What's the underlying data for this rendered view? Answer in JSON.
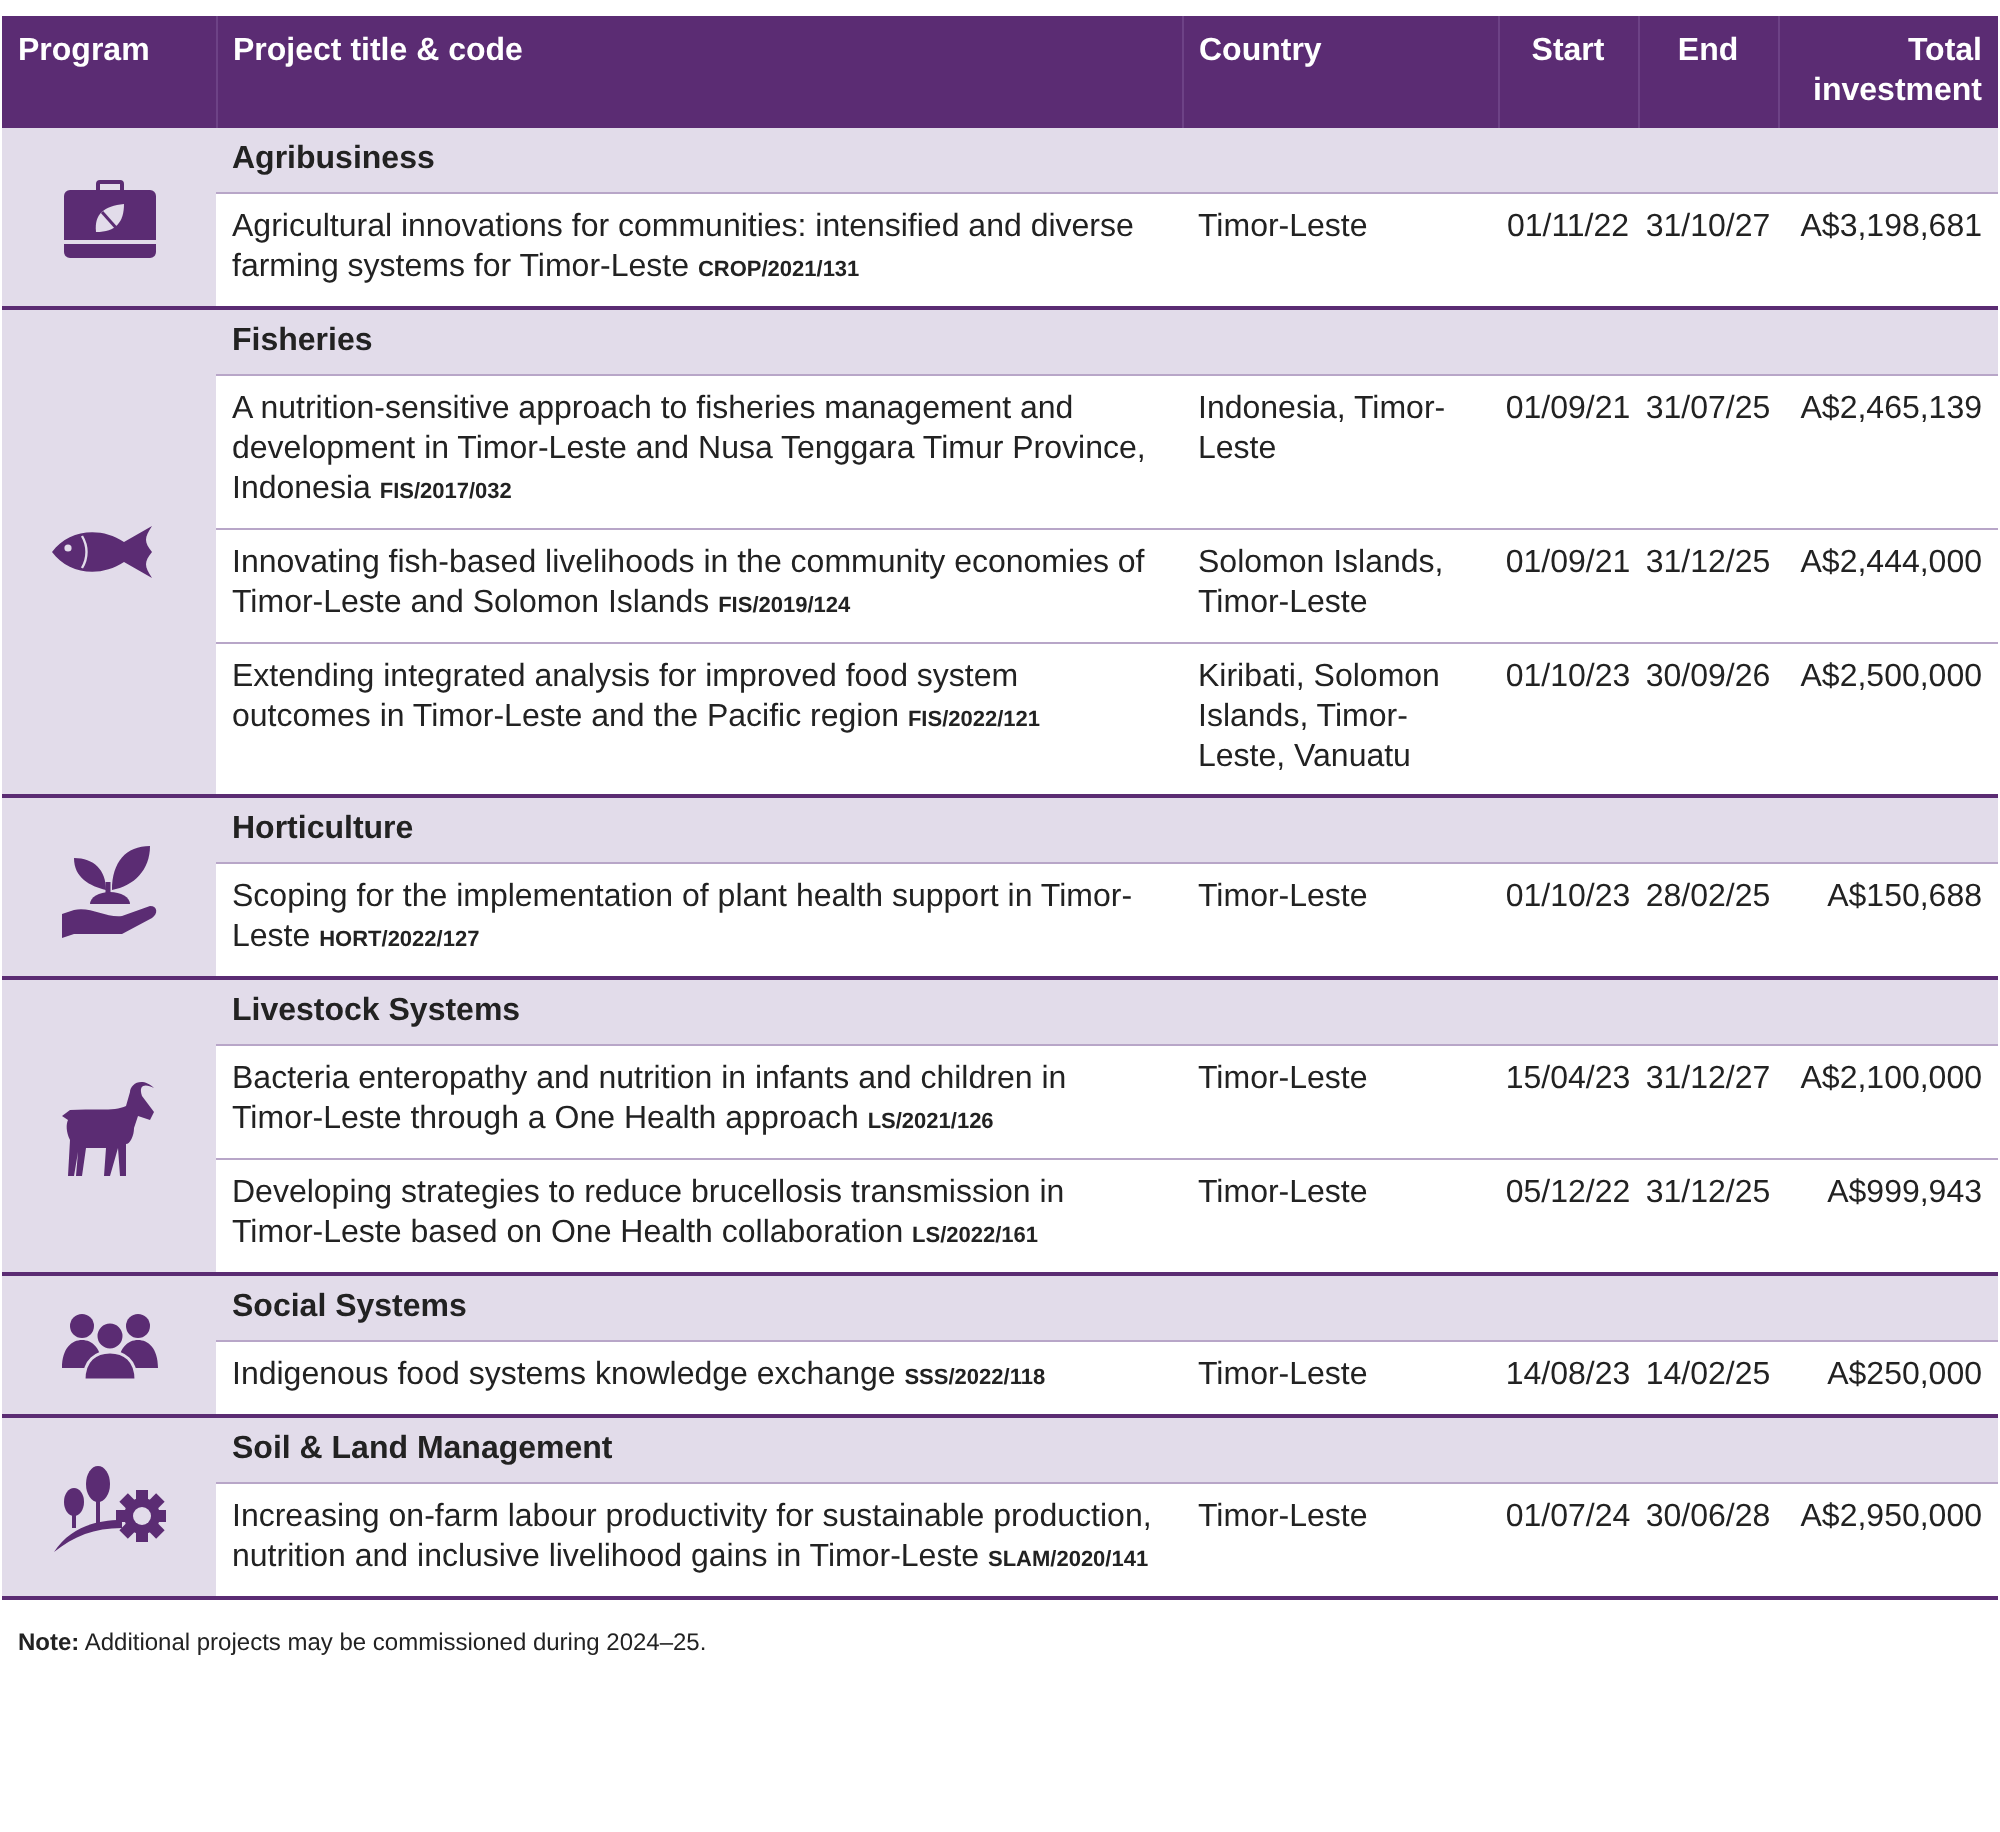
{
  "table": {
    "columns": [
      "Program",
      "Project title & code",
      "Country",
      "Start",
      "End",
      "Total investment"
    ],
    "groups": [
      {
        "program": "Agribusiness",
        "projects": [
          {
            "title": "Agricultural innovations for communities: intensified and diverse farming systems for Timor-Leste",
            "code": "CROP/2021/131",
            "country": "Timor-Leste",
            "start": "01/11/22",
            "end": "31/10/27",
            "total": "A$3,198,681"
          }
        ]
      },
      {
        "program": "Fisheries",
        "projects": [
          {
            "title": "A nutrition-sensitive approach to fisheries management and development in Timor-Leste and Nusa Tenggara Timur Province, Indonesia",
            "code": "FIS/2017/032",
            "country": "Indonesia, Timor-Leste",
            "start": "01/09/21",
            "end": "31/07/25",
            "total": "A$2,465,139"
          },
          {
            "title": "Innovating fish-based livelihoods in the community economies of Timor-Leste and Solomon Islands",
            "code": "FIS/2019/124",
            "country": "Solomon Islands, Timor-Leste",
            "start": "01/09/21",
            "end": "31/12/25",
            "total": "A$2,444,000"
          },
          {
            "title": "Extending integrated analysis for improved food system outcomes in Timor-Leste and the Pacific region",
            "code": "FIS/2022/121",
            "country": "Kiribati, Solomon Islands, Timor-Leste, Vanuatu",
            "start": "01/10/23",
            "end": "30/09/26",
            "total": "A$2,500,000"
          }
        ]
      },
      {
        "program": "Horticulture",
        "projects": [
          {
            "title": "Scoping for the implementation of plant health support in Timor-Leste",
            "code": "HORT/2022/127",
            "country": "Timor-Leste",
            "start": "01/10/23",
            "end": "28/02/25",
            "total": "A$150,688"
          }
        ]
      },
      {
        "program": "Livestock Systems",
        "projects": [
          {
            "title": "Bacteria enteropathy and nutrition in infants and children in Timor-Leste through a One Health approach",
            "code": "LS/2021/126",
            "country": "Timor-Leste",
            "start": "15/04/23",
            "end": "31/12/27",
            "total": "A$2,100,000"
          },
          {
            "title": "Developing strategies to reduce brucellosis transmission in Timor-Leste based on One Health collaboration",
            "code": "LS/2022/161",
            "country": "Timor-Leste",
            "start": "05/12/22",
            "end": "31/12/25",
            "total": "A$999,943"
          }
        ]
      },
      {
        "program": "Social Systems",
        "projects": [
          {
            "title": "Indigenous food systems knowledge exchange",
            "code": "SSS/2022/118",
            "country": "Timor-Leste",
            "start": "14/08/23",
            "end": "14/02/25",
            "total": "A$250,000"
          }
        ]
      },
      {
        "program": "Soil & Land Management",
        "projects": [
          {
            "title": "Increasing on-farm labour productivity for sustainable production, nutrition and inclusive livelihood gains in Timor-Leste",
            "code": "SLAM/2020/141",
            "country": "Timor-Leste",
            "start": "01/07/24",
            "end": "30/06/28",
            "total": "A$2,950,000"
          }
        ]
      }
    ]
  },
  "note": {
    "label": "Note:",
    "text": "Additional projects may be commissioned during 2024–25."
  }
}
